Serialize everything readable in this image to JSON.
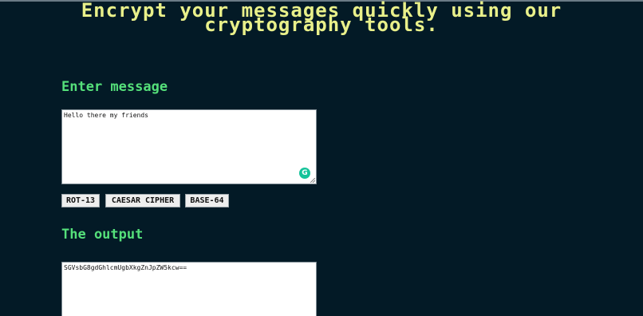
{
  "header": {
    "line1": "Encrypt your messages quickly using our",
    "line2": "cryptography tools."
  },
  "input_section": {
    "title": "Enter message",
    "value": "Hello there my friends",
    "grammarly_glyph": "G"
  },
  "buttons": {
    "rot13": "ROT-13",
    "caesar": "CAESAR CIPHER",
    "base64": "BASE-64"
  },
  "output_section": {
    "title": "The output",
    "value": "SGVsbG8gdGhlcmUgbXkgZnJpZW5kcw=="
  },
  "colors": {
    "background": "#031a26",
    "headline": "#e9f08a",
    "section_title": "#55e07a",
    "grammarly": "#15c39a"
  }
}
